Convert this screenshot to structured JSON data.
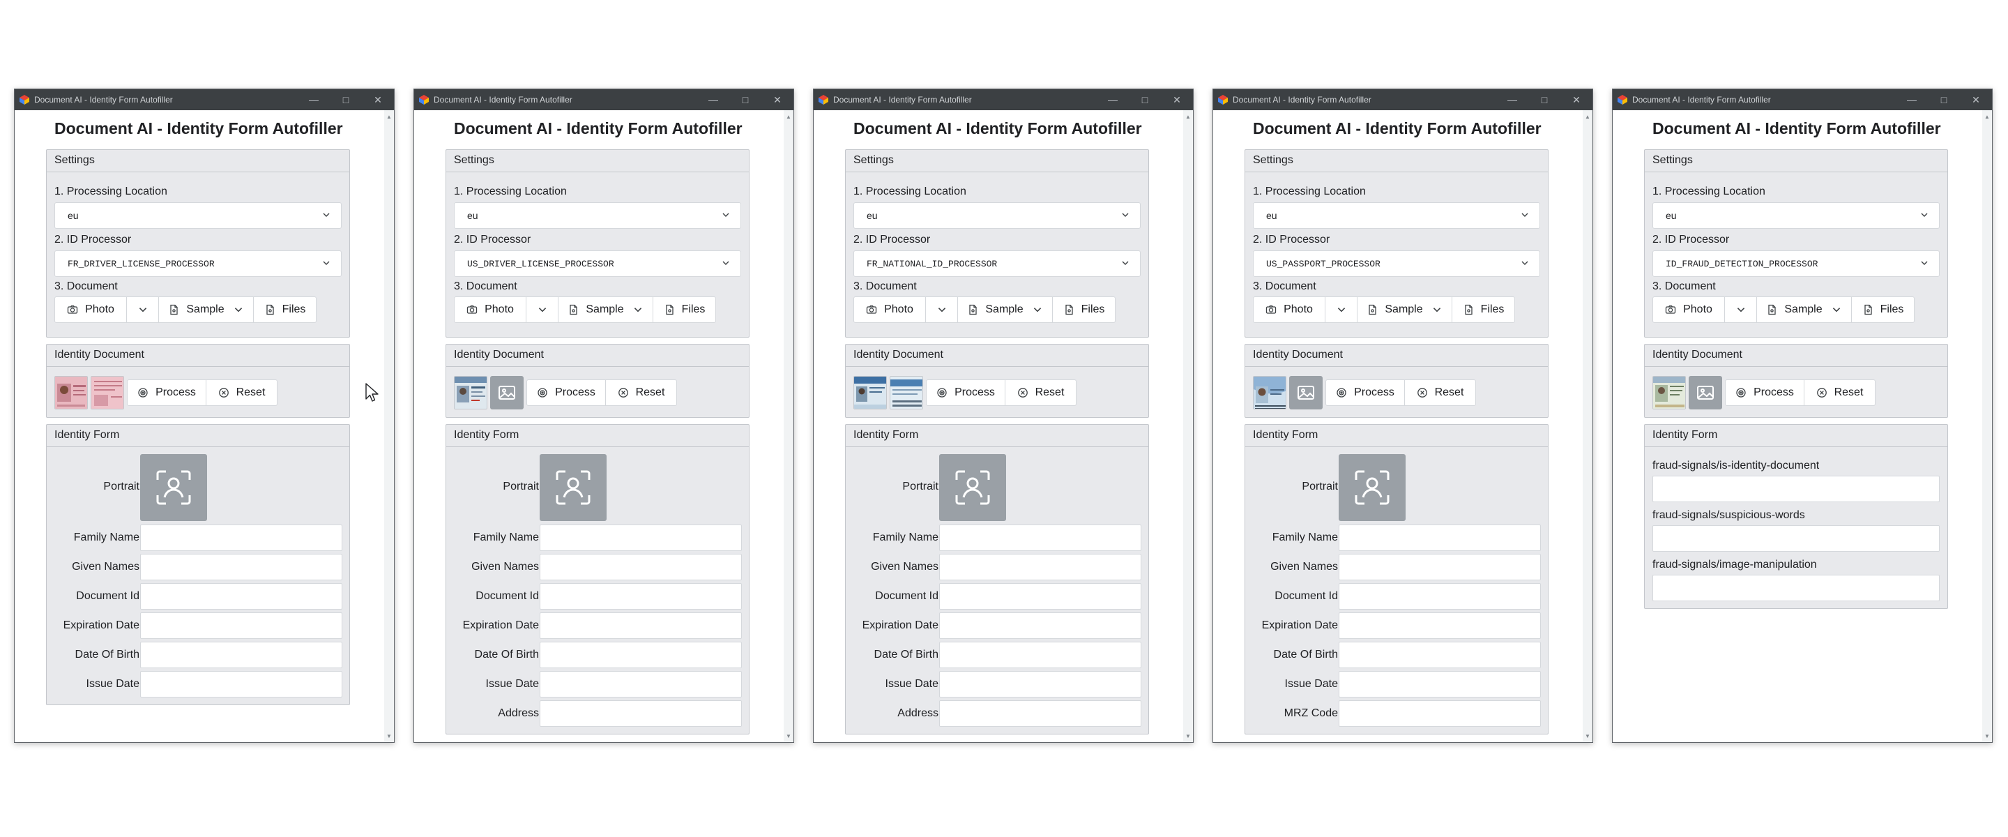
{
  "common": {
    "window_title": "Document AI - Identity Form Autofiller",
    "app_title": "Document AI - Identity Form Autofiller",
    "settings_title": "Settings",
    "location_label": "1. Processing Location",
    "location_value": "eu",
    "processor_label": "2. ID Processor",
    "document_label": "3. Document",
    "photo_label": "Photo",
    "sample_label": "Sample",
    "files_label": "Files",
    "identity_document_title": "Identity Document",
    "process_label": "Process",
    "reset_label": "Reset",
    "identity_form_title": "Identity Form",
    "portrait_label": "Portrait"
  },
  "colors": {
    "titlebar": "#3c4043",
    "panel": "#e8e9ec",
    "portrait_placeholder": "#9aa0a6"
  },
  "windows": [
    {
      "processor": "FR_DRIVER_LICENSE_PROCESSOR",
      "thumbs": [
        "license-front-thumbnail",
        "license-back-thumbnail"
      ],
      "fields": [
        "Family Name",
        "Given Names",
        "Document Id",
        "Expiration Date",
        "Date Of Birth",
        "Issue Date"
      ]
    },
    {
      "processor": "US_DRIVER_LICENSE_PROCESSOR",
      "thumbs": [
        "license-thumbnail",
        "image-placeholder-icon"
      ],
      "fields": [
        "Family Name",
        "Given Names",
        "Document Id",
        "Expiration Date",
        "Date Of Birth",
        "Issue Date",
        "Address"
      ]
    },
    {
      "processor": "FR_NATIONAL_ID_PROCESSOR",
      "thumbs": [
        "id-card-front-thumbnail",
        "id-card-back-thumbnail"
      ],
      "fields": [
        "Family Name",
        "Given Names",
        "Document Id",
        "Expiration Date",
        "Date Of Birth",
        "Issue Date",
        "Address"
      ]
    },
    {
      "processor": "US_PASSPORT_PROCESSOR",
      "thumbs": [
        "passport-thumbnail",
        "image-placeholder-icon"
      ],
      "fields": [
        "Family Name",
        "Given Names",
        "Document Id",
        "Expiration Date",
        "Date Of Birth",
        "Issue Date",
        "MRZ Code"
      ]
    },
    {
      "processor": "ID_FRAUD_DETECTION_PROCESSOR",
      "thumbs": [
        "document-thumbnail",
        "image-placeholder-icon"
      ],
      "fraud_fields": [
        "fraud-signals/is-identity-document",
        "fraud-signals/suspicious-words",
        "fraud-signals/image-manipulation"
      ]
    }
  ]
}
